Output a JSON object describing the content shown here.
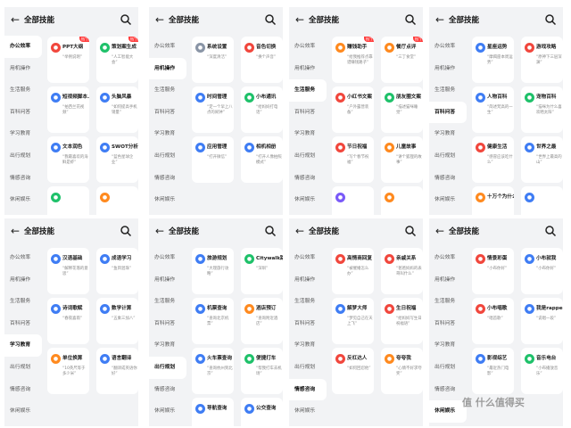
{
  "app": {
    "title": "全部技能",
    "back_icon": "arrow-left-icon",
    "search_icon": "search-icon"
  },
  "categories": [
    "办公效率",
    "用机操作",
    "生活服务",
    "百科问答",
    "学习教育",
    "出行规划",
    "情感咨询",
    "休闲娱乐"
  ],
  "hot_badge": "热门",
  "watermark": "值 什么值得买",
  "colors": {
    "blue": "#3f7df4",
    "green": "#1fc16a",
    "orange": "#ff8a1f",
    "red": "#f1473d",
    "purple": "#7a5af8",
    "gray": "#8a95a6",
    "panel_bg": "#f2f3f5"
  },
  "panels": [
    {
      "active": 0,
      "cards": [
        {
          "name": "PPT大纲",
          "desc": "“举例说明”",
          "icon": "ppt-icon",
          "color": "red",
          "hot": true
        },
        {
          "name": "策划案生成",
          "desc": "“人工智能大会”",
          "icon": "plan-icon",
          "color": "green",
          "hot": true
        },
        {
          "name": "短视频脚本...",
          "desc": "“拍西兰花视频”",
          "icon": "video-icon",
          "color": "blue"
        },
        {
          "name": "头脑风暴",
          "desc": "“如何提高手机销量”",
          "icon": "bulb-icon",
          "color": "blue"
        },
        {
          "name": "文本润色",
          "desc": "“我最喜欢的海鲜是虾”",
          "icon": "edit-icon",
          "color": "blue"
        },
        {
          "name": "SWOT分析",
          "desc": "“蓝色星球企业”",
          "icon": "chart-icon",
          "color": "blue"
        },
        {
          "name": "",
          "desc": "",
          "icon": "doc-icon",
          "color": "green"
        },
        {
          "name": "",
          "desc": "",
          "icon": "write-icon",
          "color": "orange"
        }
      ]
    },
    {
      "active": 1,
      "cards": [
        {
          "name": "系统设置",
          "desc": "“深度清洁”",
          "icon": "gear-icon",
          "color": "gray"
        },
        {
          "name": "音色切换",
          "desc": "“换个声音”",
          "icon": "voice-icon",
          "color": "red"
        },
        {
          "name": "时间管理",
          "desc": "“定一个早上八点的闹钟”",
          "icon": "clock-icon",
          "color": "blue"
        },
        {
          "name": "小布通讯",
          "desc": "“给妈妈打电话”",
          "icon": "phone-icon",
          "color": "green"
        },
        {
          "name": "应用管理",
          "desc": "“打开微信”",
          "icon": "apps-icon",
          "color": "blue"
        },
        {
          "name": "相机相册",
          "desc": "“打开人像拍照模式”",
          "icon": "camera-icon",
          "color": "blue"
        }
      ]
    },
    {
      "active": 2,
      "cards": [
        {
          "name": "赚钱助手",
          "desc": "“给我推荐点靠谱赚钱路子”",
          "icon": "money-icon",
          "color": "orange",
          "hot": true
        },
        {
          "name": "餐厅点评",
          "desc": "“三丁食堂”",
          "icon": "food-icon",
          "color": "orange",
          "hot": true
        },
        {
          "name": "小红书文案",
          "desc": "“户外露营装备”",
          "icon": "note-icon",
          "color": "red"
        },
        {
          "name": "朋友圈文案",
          "desc": "“描述猫咪睡觉”",
          "icon": "moments-icon",
          "color": "green"
        },
        {
          "name": "节日祝福",
          "desc": "“写个春节祝福”",
          "icon": "gift-icon",
          "color": "red"
        },
        {
          "name": "儿童故事",
          "desc": "“讲个狐狸的故事”",
          "icon": "book-icon",
          "color": "orange"
        },
        {
          "name": "",
          "desc": "",
          "icon": "search-icon",
          "color": "purple"
        },
        {
          "name": "",
          "desc": "",
          "icon": "calendar-icon",
          "color": "orange"
        }
      ]
    },
    {
      "active": 3,
      "cards": [
        {
          "name": "星座运势",
          "desc": "“摩羯座本周运势”",
          "icon": "star-icon",
          "color": "blue"
        },
        {
          "name": "游戏攻略",
          "desc": "“原神下三层深渊”",
          "icon": "game-icon",
          "color": "red"
        },
        {
          "name": "人物百科",
          "desc": "“简述梵高的一生”",
          "icon": "person-icon",
          "color": "blue"
        },
        {
          "name": "宠物百科",
          "desc": "“猫咪为什么喜欢晒太阳”",
          "icon": "paw-icon",
          "color": "green"
        },
        {
          "name": "健康生活",
          "desc": "“感冒应该吃什么”",
          "icon": "heart-icon",
          "color": "red"
        },
        {
          "name": "世界之最",
          "desc": "“世界上最高的山”",
          "icon": "globe-icon",
          "color": "blue"
        },
        {
          "name": "十万个为什么",
          "desc": "",
          "icon": "question-icon",
          "color": "orange"
        },
        {
          "name": "",
          "desc": "",
          "icon": "book-icon",
          "color": "blue"
        }
      ]
    },
    {
      "active": 4,
      "cards": [
        {
          "name": "汉语基础",
          "desc": "“解释花落的意思”",
          "icon": "text-icon",
          "color": "blue"
        },
        {
          "name": "成语学习",
          "desc": "“鱼目混珠”",
          "icon": "learn-icon",
          "color": "blue"
        },
        {
          "name": "诗词歌赋",
          "desc": "“春夜喜雨”",
          "icon": "poem-icon",
          "color": "blue"
        },
        {
          "name": "数学计算",
          "desc": "“五乘三加八”",
          "icon": "calc-icon",
          "color": "blue"
        },
        {
          "name": "单位换算",
          "desc": "“10英尺等于多少米”",
          "icon": "unit-icon",
          "color": "orange"
        },
        {
          "name": "语言翻译",
          "desc": "“翻译成英语你好”",
          "icon": "translate-icon",
          "color": "blue"
        }
      ]
    },
    {
      "active": 5,
      "cards": [
        {
          "name": "旅游规划",
          "desc": "“大理旅行攻略”",
          "icon": "travel-icon",
          "color": "blue"
        },
        {
          "name": "Citywalk路线",
          "desc": "“深圳”",
          "icon": "walk-icon",
          "color": "green"
        },
        {
          "name": "机票查询",
          "desc": "“查询北京机票”",
          "icon": "plane-icon",
          "color": "blue"
        },
        {
          "name": "酒店预订",
          "desc": "“查询附近酒店”",
          "icon": "hotel-icon",
          "color": "orange"
        },
        {
          "name": "火车票查询",
          "desc": "“查询杭州到北京”",
          "icon": "train-icon",
          "color": "blue"
        },
        {
          "name": "便捷打车",
          "desc": "“帮我打车去机场”",
          "icon": "car-icon",
          "color": "green"
        },
        {
          "name": "导航查询",
          "desc": "",
          "icon": "nav-icon",
          "color": "blue"
        },
        {
          "name": "公交查询",
          "desc": "",
          "icon": "bus-icon",
          "color": "blue"
        }
      ]
    },
    {
      "active": 6,
      "cards": [
        {
          "name": "高情商回复",
          "desc": "“被催婚怎么办”",
          "icon": "chat-icon",
          "color": "red"
        },
        {
          "name": "亲戚关系",
          "desc": "“爸爸妈妈的表哥叫什么”",
          "icon": "family-icon",
          "color": "red"
        },
        {
          "name": "解梦大师",
          "desc": "“梦见自己在天上飞”",
          "icon": "dream-icon",
          "color": "blue"
        },
        {
          "name": "生日祝福",
          "desc": "“给妈妈写生日祝福语”",
          "icon": "cake-icon",
          "color": "red"
        },
        {
          "name": "反杠达人",
          "desc": "“如何回怼他”",
          "icon": "debate-icon",
          "color": "red"
        },
        {
          "name": "夸夸我",
          "desc": "“心情不好求夸奖”",
          "icon": "thumb-icon",
          "color": "orange"
        }
      ]
    },
    {
      "active": 7,
      "cards": [
        {
          "name": "情景彩蛋",
          "desc": "“小布你好”",
          "icon": "egg-icon",
          "color": "red"
        },
        {
          "name": "小布就我",
          "desc": "“小布你好”",
          "icon": "smile-icon",
          "color": "blue"
        },
        {
          "name": "小布唱歌",
          "desc": "“唱首歌”",
          "icon": "music-icon",
          "color": "red"
        },
        {
          "name": "我是rapper",
          "desc": "“说唱一段”",
          "icon": "mic-icon",
          "color": "blue"
        },
        {
          "name": "影视综艺",
          "desc": "“最近热门电影”",
          "icon": "tv-icon",
          "color": "blue"
        },
        {
          "name": "音乐电台",
          "desc": "“小布播放音乐”",
          "icon": "radio-icon",
          "color": "green"
        }
      ]
    }
  ]
}
